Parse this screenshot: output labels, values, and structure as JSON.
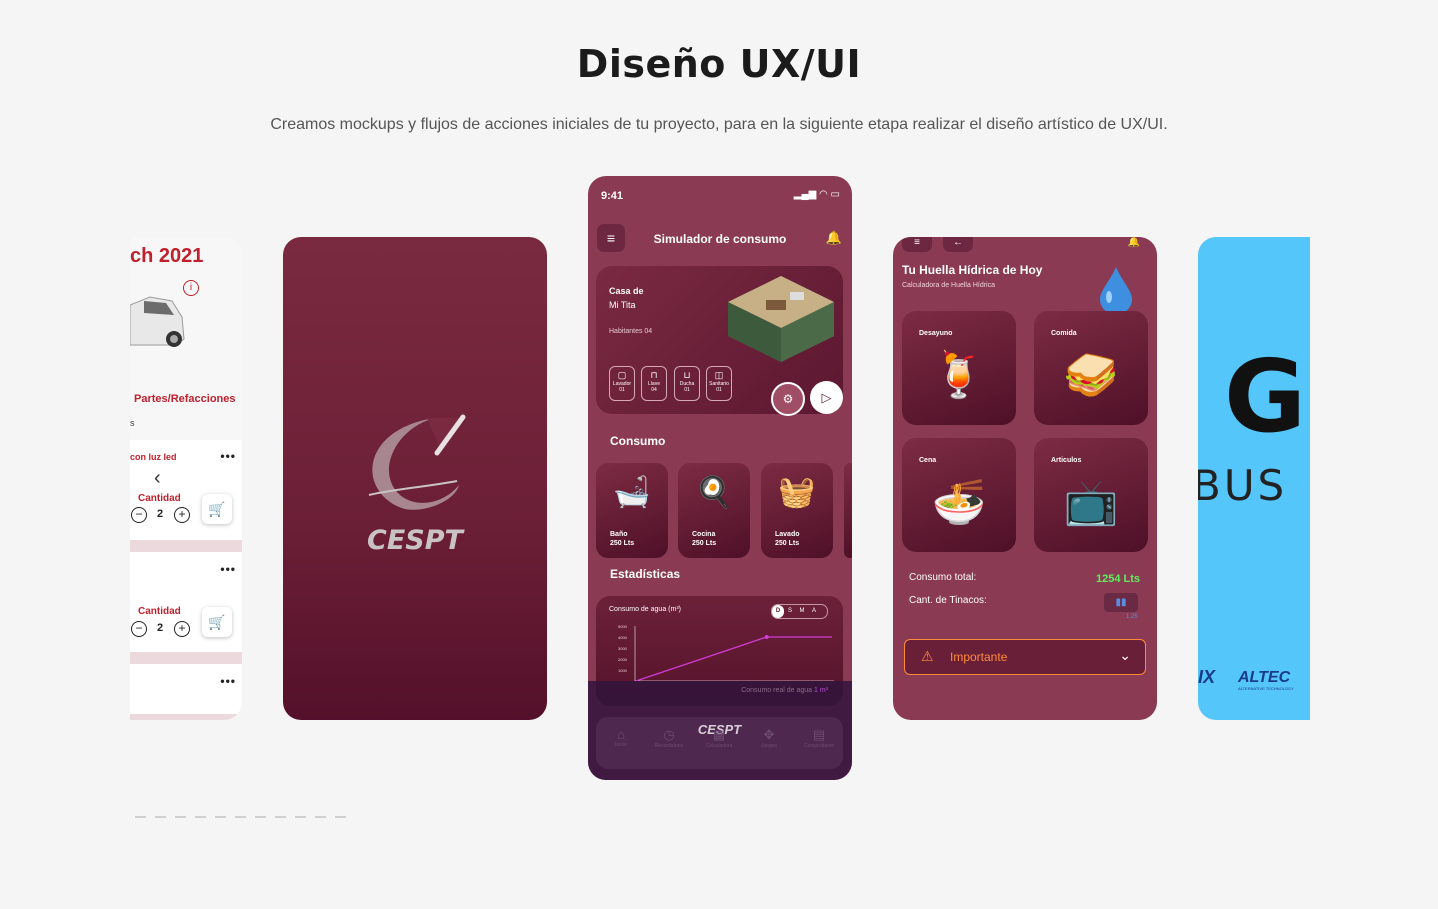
{
  "header": {
    "title": "Diseño UX/UI",
    "subtitle": "Creamos mockups y flujos de acciones iniciales de tu proyecto, para en la siguiente etapa realizar el diseño artístico de UX/UI."
  },
  "card1": {
    "heading": "ch 2021",
    "section": "Partes/Refacciones",
    "s": "s",
    "product": "con luz led",
    "qty_label": "Cantidad",
    "qty_value": "2",
    "qty_label2": "Cantidad",
    "qty_value2": "2"
  },
  "card2": {
    "logo_text": "CESPT"
  },
  "phone": {
    "time": "9:41",
    "title": "Simulador de consumo",
    "house": {
      "name1": "Casa de",
      "name2": "Mi Tita",
      "habitantes": "Habitantes 04",
      "chips": [
        {
          "label": "Lavador",
          "value": "01"
        },
        {
          "label": "Llave",
          "value": "04"
        },
        {
          "label": "Ducha",
          "value": "01"
        },
        {
          "label": "Sanitario",
          "value": "01"
        }
      ]
    },
    "consumo_title": "Consumo",
    "consumo": [
      {
        "name": "Baño",
        "value": "250 Lts",
        "icon": "bathroom-3d-icon"
      },
      {
        "name": "Cocina",
        "value": "250 Lts",
        "icon": "kitchen-3d-icon"
      },
      {
        "name": "Lavado",
        "value": "250 Lts",
        "icon": "washer-3d-icon"
      }
    ],
    "stats_title": "Estadísticas",
    "chart_label": "Consumo de agua (m³)",
    "segments": [
      "D",
      "S",
      "M",
      "A"
    ],
    "note_prefix": "Consumo real de agua",
    "note_value": "1 m³",
    "nav_logo": "CESPT",
    "nav": [
      "Inicio",
      "Recordatorio",
      "Calculadora",
      "Juegos",
      "Comprobante"
    ]
  },
  "chart_data": {
    "type": "line",
    "title": "Consumo de agua (m³)",
    "yticks": [
      "5000",
      "4000",
      "3000",
      "2000",
      "1000"
    ],
    "ylim": [
      0,
      5000
    ],
    "x": [
      0,
      1,
      2,
      3,
      4,
      5,
      6
    ],
    "series": [
      {
        "values": [
          0,
          1000,
          2000,
          3000,
          4000,
          4000,
          4000
        ]
      }
    ],
    "color": "#d23bd8"
  },
  "card4": {
    "title": "Tu Huella Hídrica de Hoy",
    "subtitle": "Calculadora de Huella Hídrica",
    "tiles": [
      {
        "label": "Desayuno",
        "icon": "breakfast-3d-icon"
      },
      {
        "label": "Comida",
        "icon": "sandwich-beer-3d-icon"
      },
      {
        "label": "Cena",
        "icon": "ramen-bowl-3d-icon"
      },
      {
        "label": "Articulos",
        "icon": "tv-furniture-3d-icon"
      }
    ],
    "total_label": "Consumo total:",
    "total_value": "1254 Lts",
    "tinacos_label": "Cant. de Tinacos:",
    "tinacos_value": "1.25",
    "important": "Importante"
  },
  "card5": {
    "logo_letter": "G",
    "logo_word": "BUS",
    "partner1": "IX",
    "partner2": "ALTEC",
    "partner2_sub": "ALTERNATIVE TECHNOLOGY"
  },
  "colors": {
    "accent_red": "#c0202d",
    "wine": "#8a3a53",
    "chart_line": "#d23bd8",
    "highlight_green": "#5cf05c",
    "warning_orange": "#ff8a3a",
    "sky": "#55c6fa"
  }
}
